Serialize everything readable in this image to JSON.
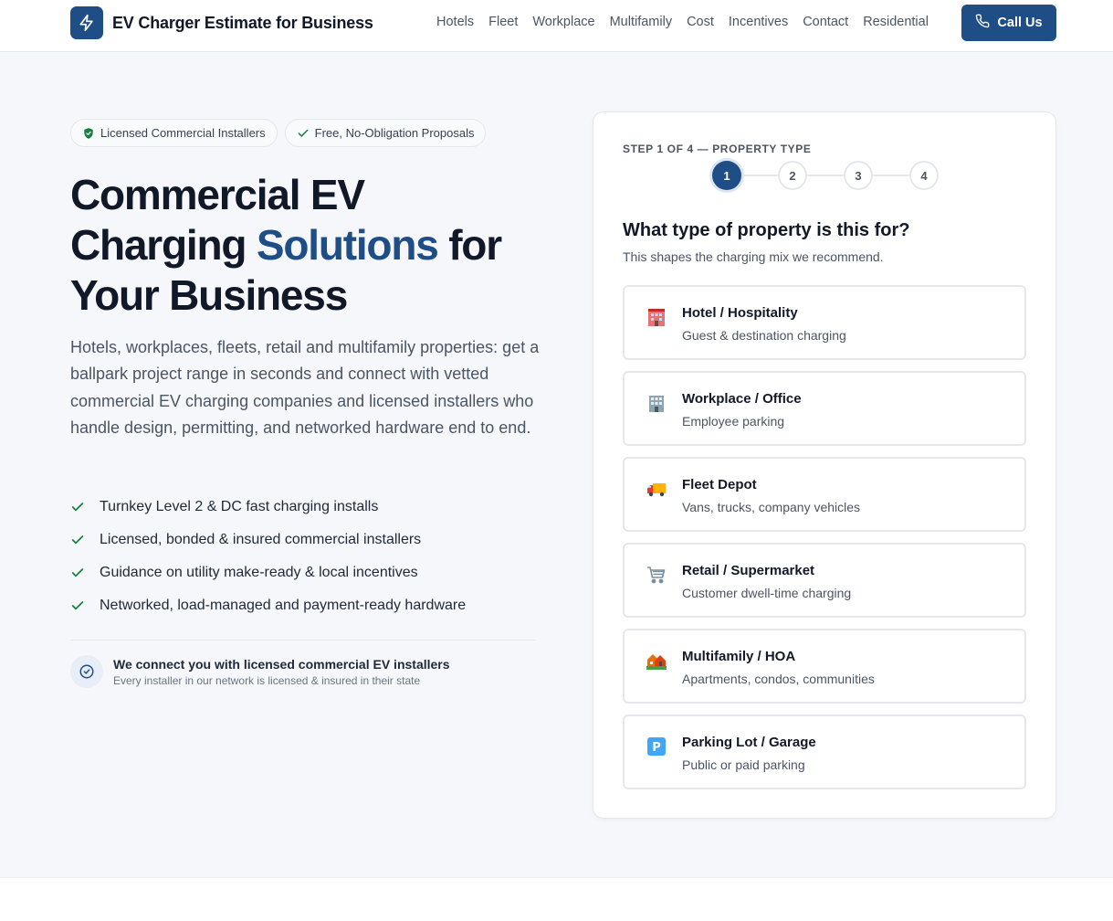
{
  "brand": {
    "name": "EV Charger Estimate for Business",
    "logo_icon": "lightning-bolt-icon"
  },
  "nav": [
    "Hotels",
    "Fleet",
    "Workplace",
    "Multifamily",
    "Cost",
    "Incentives",
    "Contact",
    "Residential"
  ],
  "call_button": {
    "label": "Call Us",
    "icon": "phone-icon"
  },
  "badges": [
    {
      "label": "Licensed Commercial Installers",
      "icon": "shield-check-icon"
    },
    {
      "label": "Free, No-Obligation Proposals",
      "icon": "check-icon"
    }
  ],
  "hero": {
    "title_part1": "Commercial EV Charging ",
    "title_accent": "Solutions",
    "title_part2": " for Your Business",
    "description": "Hotels, workplaces, fleets, retail and multifamily properties: get a ballpark project range in seconds and connect with vetted commercial EV charging companies and licensed installers who handle design, permitting, and networked hardware end to end."
  },
  "features": [
    "Turnkey Level 2 & DC fast charging installs",
    "Licensed, bonded & insured commercial installers",
    "Guidance on utility make-ready & local incentives",
    "Networked, load-managed and payment-ready hardware"
  ],
  "trust": {
    "title": "We connect you with licensed commercial EV installers",
    "subtitle": "Every installer in our network is licensed & insured in their state"
  },
  "wizard": {
    "step_label": "STEP 1 OF 4 — PROPERTY TYPE",
    "steps": [
      "1",
      "2",
      "3",
      "4"
    ],
    "current_step": 1,
    "question": "What type of property is this for?",
    "subtext": "This shapes the charging mix we recommend.",
    "options": [
      {
        "title": "Hotel / Hospitality",
        "subtitle": "Guest & destination charging",
        "icon": "hotel-icon"
      },
      {
        "title": "Workplace / Office",
        "subtitle": "Employee parking",
        "icon": "office-building-icon"
      },
      {
        "title": "Fleet Depot",
        "subtitle": "Vans, trucks, company vehicles",
        "icon": "delivery-truck-icon"
      },
      {
        "title": "Retail / Supermarket",
        "subtitle": "Customer dwell-time charging",
        "icon": "shopping-cart-icon"
      },
      {
        "title": "Multifamily / HOA",
        "subtitle": "Apartments, condos, communities",
        "icon": "houses-icon"
      },
      {
        "title": "Parking Lot / Garage",
        "subtitle": "Public or paid parking",
        "icon": "parking-icon"
      }
    ]
  },
  "colors": {
    "primary": "#1f4d86",
    "check_green": "#16803c",
    "background": "#f5f7fa"
  }
}
